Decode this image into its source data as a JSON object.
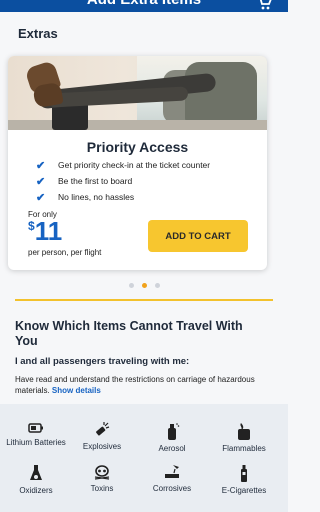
{
  "header": {
    "title": "Add Extra Items"
  },
  "extras": {
    "title": "Extras",
    "card": {
      "heading": "Priority Access",
      "benefits": [
        "Get priority check-in at the ticket counter",
        "Be the first to board",
        "No lines, no hassles"
      ],
      "for_only": "For only",
      "currency": "$",
      "amount": "11",
      "per": "per person, per flight",
      "add_button": "ADD TO CART"
    },
    "carousel": {
      "total": 3,
      "active_index": 1
    }
  },
  "restrictions": {
    "title": "Know Which Items Cannot Travel With You",
    "subtitle": "I and all passengers traveling with me:",
    "text": "Have read and understand the restrictions on carriage of hazardous materials.",
    "link": "Show details",
    "items": [
      {
        "label": "Lithium Batteries",
        "icon": "battery-icon"
      },
      {
        "label": "Explosives",
        "icon": "explosives-icon"
      },
      {
        "label": "Aerosol",
        "icon": "aerosol-icon"
      },
      {
        "label": "Flammables",
        "icon": "flammables-icon"
      },
      {
        "label": "Oxidizers",
        "icon": "oxidizers-icon"
      },
      {
        "label": "Toxins",
        "icon": "toxins-icon"
      },
      {
        "label": "Corrosives",
        "icon": "corrosives-icon"
      },
      {
        "label": "E-Cigarettes",
        "icon": "e-cigarette-icon"
      }
    ]
  },
  "colors": {
    "brand_blue": "#0b4fa0",
    "accent_yellow": "#f7c62f",
    "price_blue": "#1763c2",
    "dot_active": "#f1a21b"
  }
}
